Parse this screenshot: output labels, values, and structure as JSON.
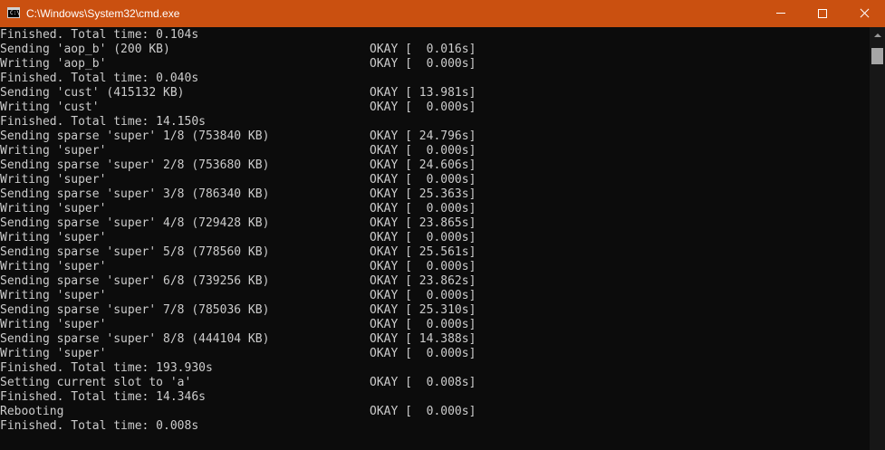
{
  "window": {
    "title": "C:\\Windows\\System32\\cmd.exe",
    "icon_text": "C:\\",
    "controls": [
      "minimize",
      "maximize",
      "close"
    ]
  },
  "console": {
    "lines": [
      {
        "text": "Finished. Total time: 0.104s",
        "status": ""
      },
      {
        "text": "Sending 'aop_b' (200 KB)",
        "status": "OKAY [  0.016s]"
      },
      {
        "text": "Writing 'aop_b'",
        "status": "OKAY [  0.000s]"
      },
      {
        "text": "Finished. Total time: 0.040s",
        "status": ""
      },
      {
        "text": "Sending 'cust' (415132 KB)",
        "status": "OKAY [ 13.981s]"
      },
      {
        "text": "Writing 'cust'",
        "status": "OKAY [  0.000s]"
      },
      {
        "text": "Finished. Total time: 14.150s",
        "status": ""
      },
      {
        "text": "Sending sparse 'super' 1/8 (753840 KB)",
        "status": "OKAY [ 24.796s]"
      },
      {
        "text": "Writing 'super'",
        "status": "OKAY [  0.000s]"
      },
      {
        "text": "Sending sparse 'super' 2/8 (753680 KB)",
        "status": "OKAY [ 24.606s]"
      },
      {
        "text": "Writing 'super'",
        "status": "OKAY [  0.000s]"
      },
      {
        "text": "Sending sparse 'super' 3/8 (786340 KB)",
        "status": "OKAY [ 25.363s]"
      },
      {
        "text": "Writing 'super'",
        "status": "OKAY [  0.000s]"
      },
      {
        "text": "Sending sparse 'super' 4/8 (729428 KB)",
        "status": "OKAY [ 23.865s]"
      },
      {
        "text": "Writing 'super'",
        "status": "OKAY [  0.000s]"
      },
      {
        "text": "Sending sparse 'super' 5/8 (778560 KB)",
        "status": "OKAY [ 25.561s]"
      },
      {
        "text": "Writing 'super'",
        "status": "OKAY [  0.000s]"
      },
      {
        "text": "Sending sparse 'super' 6/8 (739256 KB)",
        "status": "OKAY [ 23.862s]"
      },
      {
        "text": "Writing 'super'",
        "status": "OKAY [  0.000s]"
      },
      {
        "text": "Sending sparse 'super' 7/8 (785036 KB)",
        "status": "OKAY [ 25.310s]"
      },
      {
        "text": "Writing 'super'",
        "status": "OKAY [  0.000s]"
      },
      {
        "text": "Sending sparse 'super' 8/8 (444104 KB)",
        "status": "OKAY [ 14.388s]"
      },
      {
        "text": "Writing 'super'",
        "status": "OKAY [  0.000s]"
      },
      {
        "text": "Finished. Total time: 193.930s",
        "status": ""
      },
      {
        "text": "Setting current slot to 'a'",
        "status": "OKAY [  0.008s]"
      },
      {
        "text": "Finished. Total time: 14.346s",
        "status": ""
      },
      {
        "text": "Rebooting",
        "status": "OKAY [  0.000s]"
      },
      {
        "text": "Finished. Total time: 0.008s",
        "status": ""
      }
    ]
  },
  "colors": {
    "titlebar": "#ca5010",
    "background": "#0c0c0c",
    "text": "#cccccc"
  }
}
